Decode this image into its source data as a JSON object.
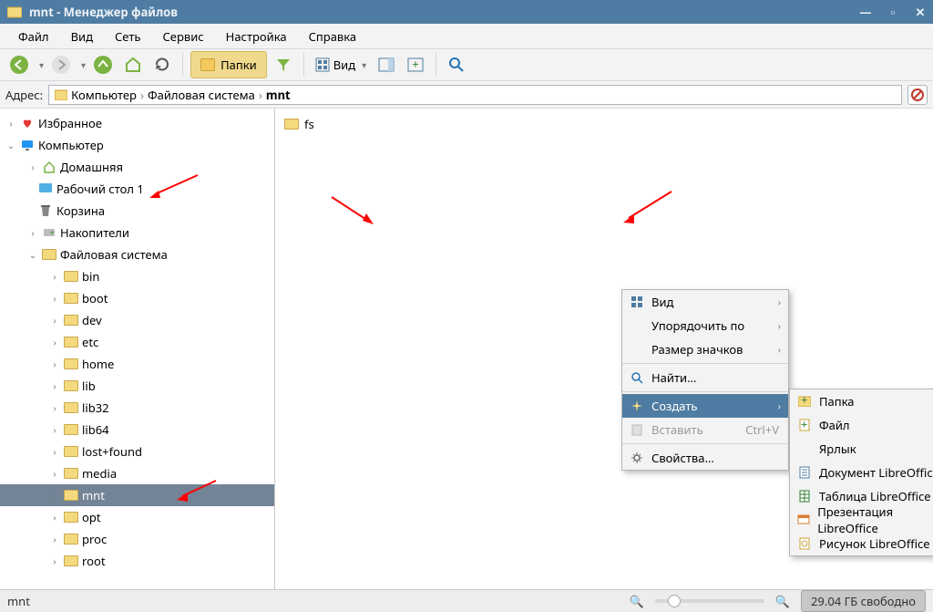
{
  "title": "mnt - Менеджер файлов",
  "menu": [
    "Файл",
    "Вид",
    "Сеть",
    "Сервис",
    "Настройка",
    "Справка"
  ],
  "toolbar": {
    "folders_btn": "Папки",
    "view_btn": "Вид"
  },
  "address": {
    "label": "Адрес:",
    "crumbs": [
      "Компьютер",
      "Файловая система",
      "mnt"
    ]
  },
  "tree": {
    "fav": "Избранное",
    "comp": "Компьютер",
    "home": "Домашняя",
    "desktop": "Рабочий стол 1",
    "trash": "Корзина",
    "drives": "Накопители",
    "fs": "Файловая система",
    "dirs": [
      "bin",
      "boot",
      "dev",
      "etc",
      "home",
      "lib",
      "lib32",
      "lib64",
      "lost+found",
      "media",
      "mnt",
      "opt",
      "proc",
      "root"
    ]
  },
  "file_pane": {
    "items": [
      "fs"
    ]
  },
  "ctx1": {
    "view": "Вид",
    "sort": "Упорядочить по",
    "iconsize": "Размер значков",
    "find": "Найти…",
    "create": "Создать",
    "paste": "Вставить",
    "paste_sc": "Ctrl+V",
    "props": "Свойства…"
  },
  "ctx2": {
    "folder": "Папка",
    "file": "Файл",
    "shortcut": "Ярлык",
    "lo_doc": "Документ LibreOffice",
    "lo_sheet": "Таблица LibreOffice",
    "lo_pres": "Презентация LibreOffice",
    "lo_draw": "Рисунок LibreOffice"
  },
  "status": {
    "path": "mnt",
    "disk": "29.04 ГБ свободно"
  }
}
